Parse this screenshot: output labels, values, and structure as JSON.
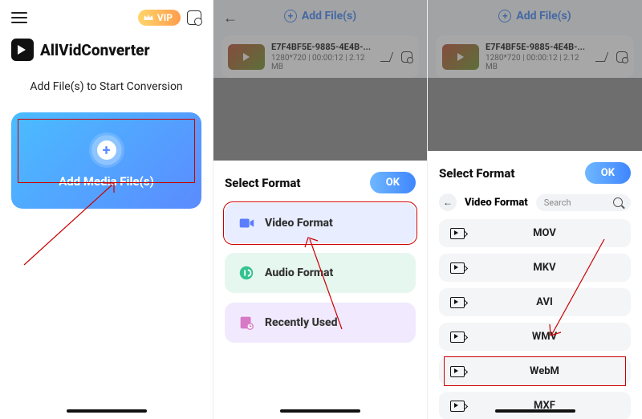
{
  "panel1": {
    "vip_label": "VIP",
    "app_name": "AllVidConverter",
    "subtitle": "Add File(s) to Start Conversion",
    "add_card_label": "Add Media File(s)"
  },
  "panel2": {
    "header_link": "Add File(s)",
    "file": {
      "name": "E7F4BF5E-9885-4E4B-...",
      "meta": "1280*720  |  00:00:12  |  2.12 MB"
    },
    "sheet_title": "Select Format",
    "ok_label": "OK",
    "options": {
      "video": "Video Format",
      "audio": "Audio Format",
      "recent": "Recently Used"
    }
  },
  "panel3": {
    "header_link": "Add File(s)",
    "file": {
      "name": "E7F4BF5E-9885-4E4B-...",
      "meta": "1280*720  |  00:00:12  |  2.12 MB"
    },
    "sheet_title": "Select Format",
    "ok_label": "OK",
    "sub_title": "Video Format",
    "search_placeholder": "Search",
    "formats": [
      "MOV",
      "MKV",
      "AVI",
      "WMV",
      "WebM",
      "MXF"
    ],
    "highlight_index": 4
  }
}
